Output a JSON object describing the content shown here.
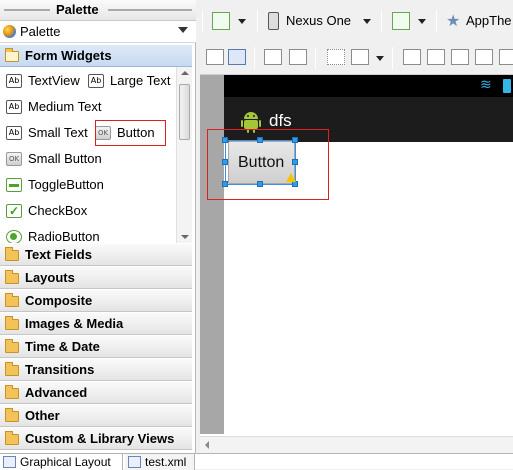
{
  "palette": {
    "title": "Palette",
    "selector_label": "Palette",
    "form_widgets_header": "Form Widgets",
    "widgets": [
      {
        "label": "TextView",
        "icon": "Ab"
      },
      {
        "label": "Large Text",
        "icon": "Ab"
      },
      {
        "label": "Medium Text",
        "icon": "Ab"
      },
      {
        "label": "Small Text",
        "icon": "Ab"
      },
      {
        "label": "Button",
        "icon": "OK"
      },
      {
        "label": "Small Button",
        "icon": "OK"
      },
      {
        "label": "ToggleButton",
        "icon": "toggle-icon"
      },
      {
        "label": "CheckBox",
        "icon": "checkbox-icon"
      },
      {
        "label": "RadioButton",
        "icon": "radio-icon"
      }
    ],
    "categories": [
      "Text Fields",
      "Layouts",
      "Composite",
      "Images & Media",
      "Time & Date",
      "Transitions",
      "Advanced",
      "Other",
      "Custom & Library Views"
    ]
  },
  "toolbar": {
    "device": "Nexus One",
    "theme": "AppThe"
  },
  "preview": {
    "app_title": "dfs",
    "button_text": "Button"
  },
  "tabs": {
    "graphical": "Graphical Layout",
    "xml": "test.xml"
  },
  "colors": {
    "selection": "#2f9bea",
    "highlight_box": "#e02020",
    "android_green": "#a4c639"
  }
}
